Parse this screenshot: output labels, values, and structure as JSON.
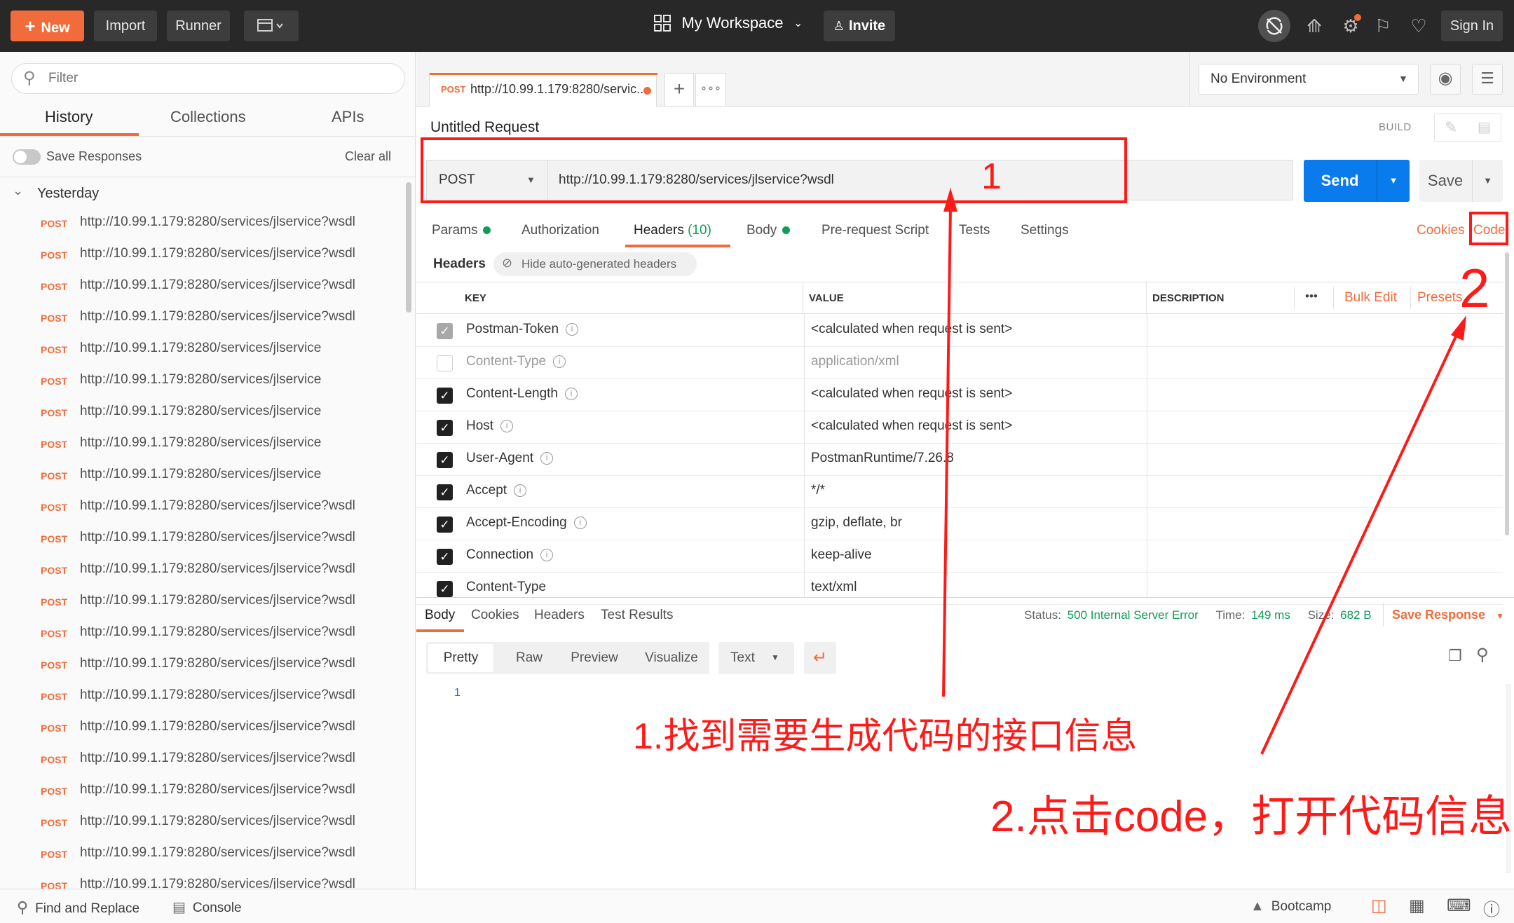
{
  "topbar": {
    "new_label": "New",
    "import_label": "Import",
    "runner_label": "Runner",
    "workspace_label": "My Workspace",
    "invite_label": "Invite",
    "signin_label": "Sign In"
  },
  "sidebar": {
    "filter_placeholder": "Filter",
    "tabs": [
      "History",
      "Collections",
      "APIs"
    ],
    "active_tab": "History",
    "save_responses_label": "Save Responses",
    "clear_all_label": "Clear all",
    "group_label": "Yesterday",
    "history": [
      {
        "method": "POST",
        "url": "http://10.99.1.179:8280/services/jlservice?wsdl"
      },
      {
        "method": "POST",
        "url": "http://10.99.1.179:8280/services/jlservice?wsdl"
      },
      {
        "method": "POST",
        "url": "http://10.99.1.179:8280/services/jlservice?wsdl"
      },
      {
        "method": "POST",
        "url": "http://10.99.1.179:8280/services/jlservice?wsdl"
      },
      {
        "method": "POST",
        "url": "http://10.99.1.179:8280/services/jlservice"
      },
      {
        "method": "POST",
        "url": "http://10.99.1.179:8280/services/jlservice"
      },
      {
        "method": "POST",
        "url": "http://10.99.1.179:8280/services/jlservice"
      },
      {
        "method": "POST",
        "url": "http://10.99.1.179:8280/services/jlservice"
      },
      {
        "method": "POST",
        "url": "http://10.99.1.179:8280/services/jlservice"
      },
      {
        "method": "POST",
        "url": "http://10.99.1.179:8280/services/jlservice?wsdl"
      },
      {
        "method": "POST",
        "url": "http://10.99.1.179:8280/services/jlservice?wsdl"
      },
      {
        "method": "POST",
        "url": "http://10.99.1.179:8280/services/jlservice?wsdl"
      },
      {
        "method": "POST",
        "url": "http://10.99.1.179:8280/services/jlservice?wsdl"
      },
      {
        "method": "POST",
        "url": "http://10.99.1.179:8280/services/jlservice?wsdl"
      },
      {
        "method": "POST",
        "url": "http://10.99.1.179:8280/services/jlservice?wsdl"
      },
      {
        "method": "POST",
        "url": "http://10.99.1.179:8280/services/jlservice?wsdl"
      },
      {
        "method": "POST",
        "url": "http://10.99.1.179:8280/services/jlservice?wsdl"
      },
      {
        "method": "POST",
        "url": "http://10.99.1.179:8280/services/jlservice?wsdl"
      },
      {
        "method": "POST",
        "url": "http://10.99.1.179:8280/services/jlservice?wsdl"
      },
      {
        "method": "POST",
        "url": "http://10.99.1.179:8280/services/jlservice?wsdl"
      },
      {
        "method": "POST",
        "url": "http://10.99.1.179:8280/services/jlservice?wsdl"
      },
      {
        "method": "POST",
        "url": "http://10.99.1.179:8280/services/jlservice?wsdl"
      }
    ]
  },
  "request_tab": {
    "method": "POST",
    "title": "http://10.99.1.179:8280/servic..."
  },
  "environment": {
    "selected": "No Environment"
  },
  "request": {
    "name": "Untitled Request",
    "build_label": "BUILD",
    "method": "POST",
    "url": "http://10.99.1.179:8280/services/jlservice?wsdl",
    "send_label": "Send",
    "save_label": "Save"
  },
  "request_tabs": {
    "params": "Params",
    "authorization": "Authorization",
    "headers": "Headers",
    "headers_count": "(10)",
    "body": "Body",
    "prerequest": "Pre-request Script",
    "tests": "Tests",
    "settings": "Settings",
    "cookies": "Cookies",
    "code": "Code"
  },
  "headers_section": {
    "title": "Headers",
    "hide_label": "Hide auto-generated headers",
    "columns": {
      "key": "KEY",
      "value": "VALUE",
      "description": "DESCRIPTION"
    },
    "more_label": "•••",
    "bulk_edit_label": "Bulk Edit",
    "presets_label": "Presets",
    "rows": [
      {
        "key": "Postman-Token",
        "value": "<calculated when request is sent>",
        "state": "grey",
        "info": true
      },
      {
        "key": "Content-Type",
        "value": "application/xml",
        "state": "empty",
        "info": true
      },
      {
        "key": "Content-Length",
        "value": "<calculated when request is sent>",
        "state": "checked",
        "info": true
      },
      {
        "key": "Host",
        "value": "<calculated when request is sent>",
        "state": "checked",
        "info": true
      },
      {
        "key": "User-Agent",
        "value": "PostmanRuntime/7.26.8",
        "state": "checked",
        "info": true
      },
      {
        "key": "Accept",
        "value": "*/*",
        "state": "checked",
        "info": true
      },
      {
        "key": "Accept-Encoding",
        "value": "gzip, deflate, br",
        "state": "checked",
        "info": true
      },
      {
        "key": "Connection",
        "value": "keep-alive",
        "state": "checked",
        "info": true
      },
      {
        "key": "Content-Type",
        "value": "text/xml",
        "state": "checked",
        "info": false
      }
    ]
  },
  "response": {
    "tabs": [
      "Body",
      "Cookies",
      "Headers",
      "Test Results"
    ],
    "status_label": "Status:",
    "status_value": "500 Internal Server Error",
    "time_label": "Time:",
    "time_value": "149 ms",
    "size_label": "Size:",
    "size_value": "682 B",
    "save_response_label": "Save Response",
    "view_modes": [
      "Pretty",
      "Raw",
      "Preview",
      "Visualize"
    ],
    "format": "Text",
    "line_number": "1"
  },
  "annotations": {
    "marker_1": "1",
    "marker_2": "2",
    "note_1": "1.找到需要生成代码的接口信息",
    "note_2": "2.点击code，打开代码信息",
    "color": "#ff1a1a"
  },
  "footer": {
    "find_replace": "Find and Replace",
    "console": "Console",
    "bootcamp": "Bootcamp"
  },
  "colors": {
    "accent_orange": "#f26b3a",
    "send_blue": "#097bed",
    "topbar": "#282828",
    "status_green": "#0f9d58"
  }
}
